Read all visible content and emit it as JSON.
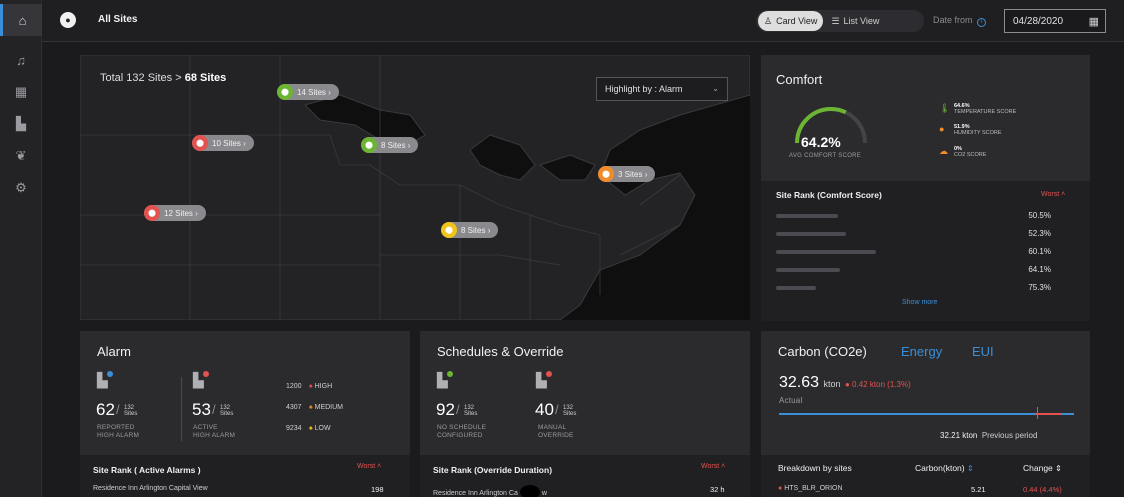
{
  "topbar": {
    "site_title": "All Sites",
    "card_view": "Card View",
    "list_view": "List View",
    "date_label": "Date from",
    "date_value": "04/28/2020"
  },
  "map": {
    "total_prefix": "Total 132 Sites > ",
    "total_bold": "68 Sites",
    "highlight": "Highlight by : Alarm",
    "pins": [
      {
        "label": "14 Sites",
        "color": "#6bb533"
      },
      {
        "label": "10 Sites",
        "color": "#e2524f"
      },
      {
        "label": "8 Sites",
        "color": "#6bb533"
      },
      {
        "label": "3 Sites",
        "color": "#f08c2a"
      },
      {
        "label": "12 Sites",
        "color": "#e2524f"
      },
      {
        "label": "8 Sites",
        "color": "#f0c419"
      }
    ]
  },
  "comfort": {
    "title": "Comfort",
    "avg_value": "64.2%",
    "avg_label": "AVG COMFORT SCORE",
    "avg_fraction": 0.642,
    "scores": [
      {
        "value": "64.6%",
        "label": "TEMPERATURE SCORE",
        "icon": "thermometer-icon",
        "color": "#6bb533"
      },
      {
        "value": "51.9%",
        "label": "HUMIDITY SCORE",
        "icon": "droplet-icon",
        "color": "#f08c2a"
      },
      {
        "value": "0%",
        "label": "CO2 SCORE",
        "icon": "cloud-icon",
        "color": "#f08c2a"
      }
    ],
    "rank_title": "Site Rank (Comfort Score)",
    "worst": "Worst",
    "rank_values": [
      "50.5%",
      "52.3%",
      "60.1%",
      "64.1%",
      "75.3%"
    ],
    "show_more": "Show more"
  },
  "alarm": {
    "title": "Alarm",
    "reported": {
      "value": "62",
      "total": "132",
      "unit": "Sites",
      "label1": "REPORTED",
      "label2": "HIGH ALARM"
    },
    "active": {
      "value": "53",
      "total": "132",
      "unit": "Sites",
      "label1": "ACTIVE",
      "label2": "HIGH ALARM"
    },
    "severities": [
      {
        "count": "1200",
        "label": "HIGH",
        "color": "#e2524f"
      },
      {
        "count": "4307",
        "label": "MEDIUM",
        "color": "#f08c2a"
      },
      {
        "count": "9234",
        "label": "LOW",
        "color": "#f0c419"
      }
    ],
    "rank_title": "Site Rank ( Active Alarms )",
    "worst": "Worst",
    "row_site": "Residence Inn Arlington Capital View",
    "row_value": "198"
  },
  "schedules": {
    "title": "Schedules & Override",
    "no_schedule": {
      "value": "92",
      "total": "132",
      "unit": "Sites",
      "label1": "NO SCHEDULE",
      "label2": "CONFIGURED"
    },
    "manual": {
      "value": "40",
      "total": "132",
      "unit": "Sites",
      "label1": "MANUAL",
      "label2": "OVERRIDE"
    },
    "rank_title": "Site Rank (Override Duration)",
    "worst": "Worst",
    "row_site": "Residence Inn Arlington Ca",
    "row_site_tail": "w",
    "row_value": "32 h"
  },
  "carbon": {
    "title": "Carbon (CO2e)",
    "tab_energy": "Energy",
    "tab_eui": "EUI",
    "value": "32.63",
    "unit": "kton",
    "delta": "0.42 kton (1.3%)",
    "actual": "Actual",
    "previous_value": "32.21 kton",
    "previous_label": "Previous period",
    "breakdown_title": "Breakdown by sites",
    "col_carbon": "Carbon(kton)",
    "col_change": "Change",
    "row_site": "HTS_BLR_ORION",
    "row_value": "5.21",
    "row_change": "0.44 (4.4%)"
  }
}
